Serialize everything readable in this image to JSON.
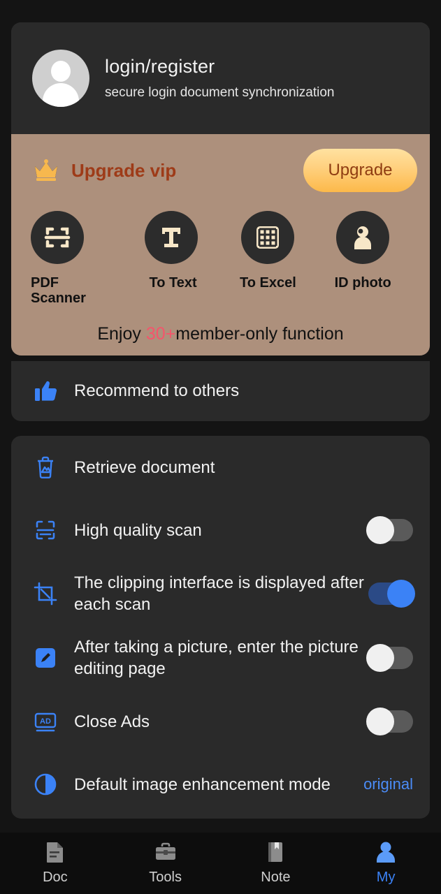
{
  "profile": {
    "avatar_icon": "user-avatar-icon",
    "title": "login/register",
    "subtitle": "secure login document synchronization"
  },
  "vip": {
    "crown_icon": "crown-icon",
    "title": "Upgrade vip",
    "button_label": "Upgrade",
    "footer_prefix": "Enjoy ",
    "footer_highlight": "30+",
    "footer_suffix": "member-only function",
    "highlight_color": "#f4556b",
    "banner_color": "#ad907c",
    "title_color": "#9e3b18",
    "features": [
      {
        "icon": "scan-frame-icon",
        "label": "PDF Scanner"
      },
      {
        "icon": "text-t-icon",
        "label": "To Text"
      },
      {
        "icon": "table-grid-icon",
        "label": "To Excel"
      },
      {
        "icon": "id-person-icon",
        "label": "ID photo"
      }
    ]
  },
  "recommend": {
    "icon": "thumbs-up-icon",
    "label": "Recommend to others"
  },
  "settings": {
    "accent_color": "#3b82f6",
    "rows": [
      {
        "icon": "retrieve-trash-icon",
        "label": "Retrieve document",
        "control": "none"
      },
      {
        "icon": "scan-quality-icon",
        "label": "High quality scan",
        "control": "toggle",
        "on": false
      },
      {
        "icon": "crop-icon",
        "label": "The clipping interface is displayed after each scan",
        "control": "toggle",
        "on": true
      },
      {
        "icon": "edit-pencil-icon",
        "label": "After taking a picture, enter the picture editing page",
        "control": "toggle",
        "on": false
      },
      {
        "icon": "ad-box-icon",
        "label": "Close Ads",
        "control": "toggle",
        "on": false
      },
      {
        "icon": "contrast-icon",
        "label": "Default image enhancement mode",
        "control": "value",
        "value": "original"
      }
    ]
  },
  "bottom_nav": {
    "items": [
      {
        "icon": "document-icon",
        "label": "Doc",
        "active": false
      },
      {
        "icon": "toolbox-icon",
        "label": "Tools",
        "active": false
      },
      {
        "icon": "note-book-icon",
        "label": "Note",
        "active": false
      },
      {
        "icon": "person-icon",
        "label": "My",
        "active": true
      }
    ]
  }
}
